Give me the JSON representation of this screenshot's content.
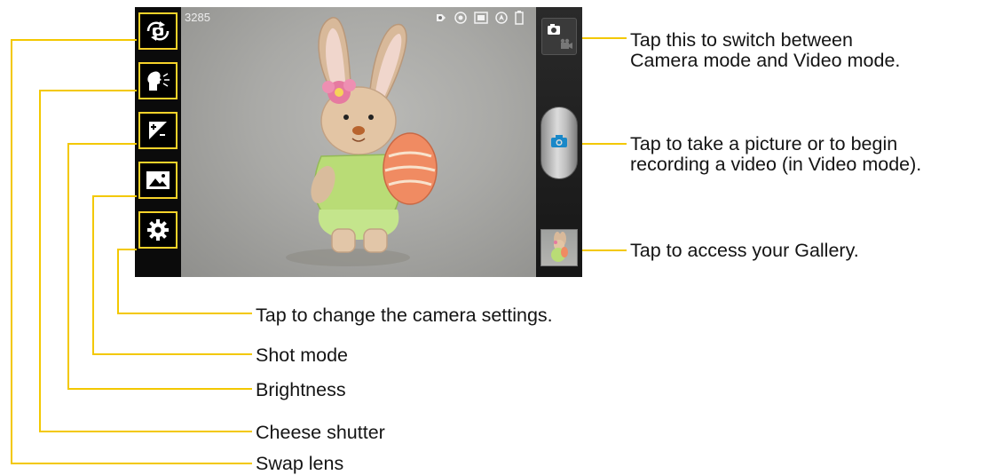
{
  "viewfinder": {
    "shot_counter": "3285"
  },
  "left_toolbar": {
    "buttons": [
      {
        "name": "swap-lens",
        "icon": "swap-lens-icon"
      },
      {
        "name": "cheese-shutter",
        "icon": "cheese-shutter-icon"
      },
      {
        "name": "brightness",
        "icon": "brightness-icon"
      },
      {
        "name": "shot-mode",
        "icon": "shot-mode-icon"
      },
      {
        "name": "settings",
        "icon": "gear-icon"
      }
    ]
  },
  "status_icons": [
    "flash-icon",
    "focus-icon",
    "resolution-icon",
    "location-icon",
    "battery-icon"
  ],
  "right_toolbar": {
    "mode_switch_icon": "camera-video-switch-icon",
    "shutter_icon": "camera-icon",
    "gallery_icon": "gallery-thumbnail"
  },
  "callouts": {
    "mode_switch": [
      "Tap this to switch between",
      "Camera mode and Video mode."
    ],
    "shutter": [
      "Tap to take a picture or to begin",
      "recording a video (in Video mode)."
    ],
    "gallery": "Tap to access your Gallery.",
    "settings": "Tap to change the camera settings.",
    "shot_mode": "Shot mode",
    "brightness": "Brightness",
    "cheese_shutter": "Cheese shutter",
    "swap_lens": "Swap lens"
  },
  "colors": {
    "callout_line": "#f3c800",
    "button_border": "#f6d22a",
    "shutter_icon": "#1a88c8"
  }
}
